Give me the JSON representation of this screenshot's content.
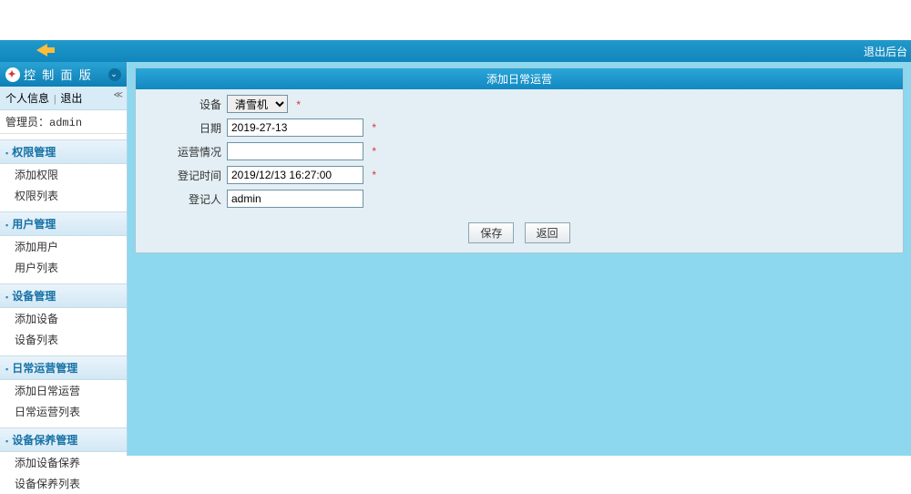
{
  "header": {
    "logout": "退出后台"
  },
  "sidebar": {
    "panel_title": "控 制 面 版",
    "user_info": "个人信息",
    "logout": "退出",
    "admin_label": "管理员：",
    "admin_value": "admin",
    "groups": [
      {
        "title": "权限管理",
        "items": [
          "添加权限",
          "权限列表"
        ]
      },
      {
        "title": "用户管理",
        "items": [
          "添加用户",
          "用户列表"
        ]
      },
      {
        "title": "设备管理",
        "items": [
          "添加设备",
          "设备列表"
        ]
      },
      {
        "title": "日常运营管理",
        "items": [
          "添加日常运营",
          "日常运营列表"
        ]
      },
      {
        "title": "设备保养管理",
        "items": [
          "添加设备保养",
          "设备保养列表"
        ]
      }
    ]
  },
  "form": {
    "title": "添加日常运营",
    "fields": {
      "device_label": "设备",
      "device_value": "清雪机",
      "date_label": "日期",
      "date_value": "2019-27-13",
      "status_label": "运营情况",
      "status_value": "",
      "regtime_label": "登记时间",
      "regtime_value": "2019/12/13 16:27:00",
      "regby_label": "登记人",
      "regby_value": "admin"
    },
    "buttons": {
      "save": "保存",
      "back": "返回"
    }
  }
}
